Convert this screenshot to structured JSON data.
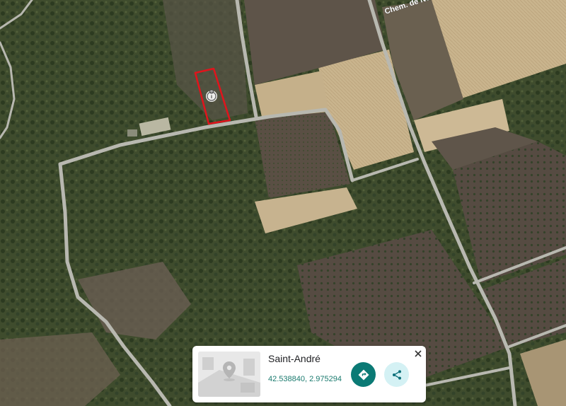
{
  "map": {
    "road_label": "Chem. de Ne",
    "colors": {
      "vegetation": "#3a4a2a",
      "field_light": "#c8b48c",
      "field_dark": "#5e5247",
      "road": "#b9b9b0",
      "parcel_outline": "#e0141c"
    }
  },
  "marker": {
    "icon": "location-pin-icon"
  },
  "place_card": {
    "name": "Saint-André",
    "coordinates": "42.538840, 2.975294",
    "thumbnail_icon": "location-placeholder-icon",
    "directions_icon": "directions-icon",
    "share_icon": "share-icon",
    "close_icon": "close-icon",
    "colors": {
      "accent": "#0b7a75",
      "share_bg": "#d4f1f4",
      "coord_text": "#1a7a6e"
    }
  }
}
